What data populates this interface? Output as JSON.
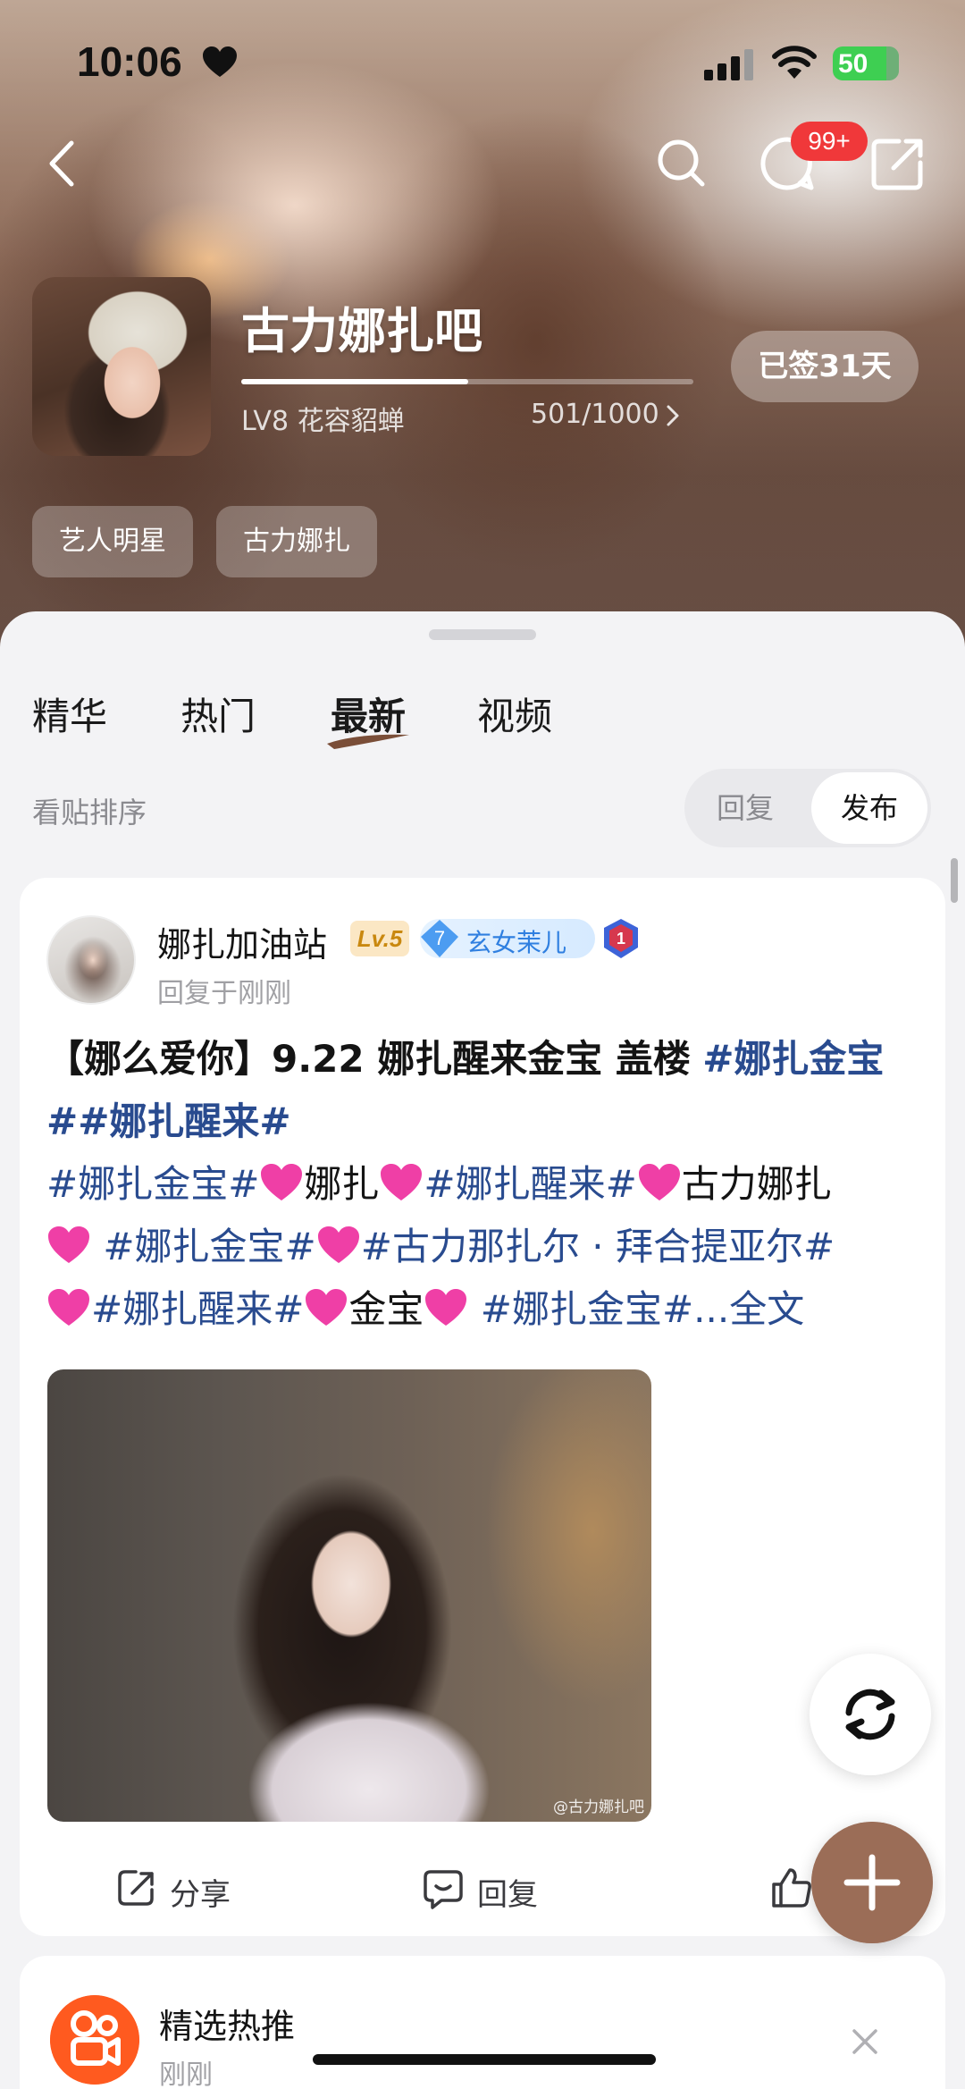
{
  "status_bar": {
    "time": "10:06",
    "battery": "50"
  },
  "top_nav": {
    "messages_badge": "99+"
  },
  "forum": {
    "name": "古力娜扎吧",
    "level_label": "LV8 花容貂蝉",
    "level_progress_text": "501/1000",
    "level_progress_fraction": 0.501,
    "signin_label": "已签31天",
    "tags": [
      "艺人明星",
      "古力娜扎"
    ]
  },
  "tabs": [
    "精华",
    "热门",
    "最新",
    "视频"
  ],
  "active_tab": "最新",
  "sort": {
    "label": "看贴排序",
    "options": [
      "回复",
      "发布"
    ],
    "selected": "发布"
  },
  "post": {
    "author": "娜扎加油站",
    "level_badge": "Lv.5",
    "honor_level": "7",
    "honor_title": "玄女茉儿",
    "rank": "1",
    "time": "回复于刚刚",
    "title": "【娜么爱你】9.22 娜扎醒来金宝 盖楼",
    "title_topic": "#娜扎金宝##娜扎醒来#",
    "body": {
      "t1": "#娜扎金宝#",
      "t2": "娜扎",
      "t3": "#娜扎醒来#",
      "t4": "古力娜扎",
      "t5": "#娜扎金宝#",
      "t6": "#古力那扎尔 · 拜合提亚尔#",
      "t7": "#娜扎醒来#",
      "t8": "金宝",
      "t9": "#娜扎金宝#",
      "more": "...全文"
    },
    "image_watermark": "@古力娜扎吧",
    "actions": {
      "share": "分享",
      "reply": "回复"
    }
  },
  "recommend": {
    "title": "精选热推",
    "subtitle": "刚刚"
  },
  "colors": {
    "accent_brown": "#9b6d57",
    "topic_blue": "#294b8f",
    "badge_red": "#f0383a",
    "battery_green": "#3ecf52"
  },
  "icons": [
    "back-icon",
    "search-icon",
    "message-icon",
    "share-icon",
    "refresh-icon",
    "add-icon",
    "heart-icon",
    "close-icon",
    "thumbs-up-icon",
    "reply-icon"
  ]
}
